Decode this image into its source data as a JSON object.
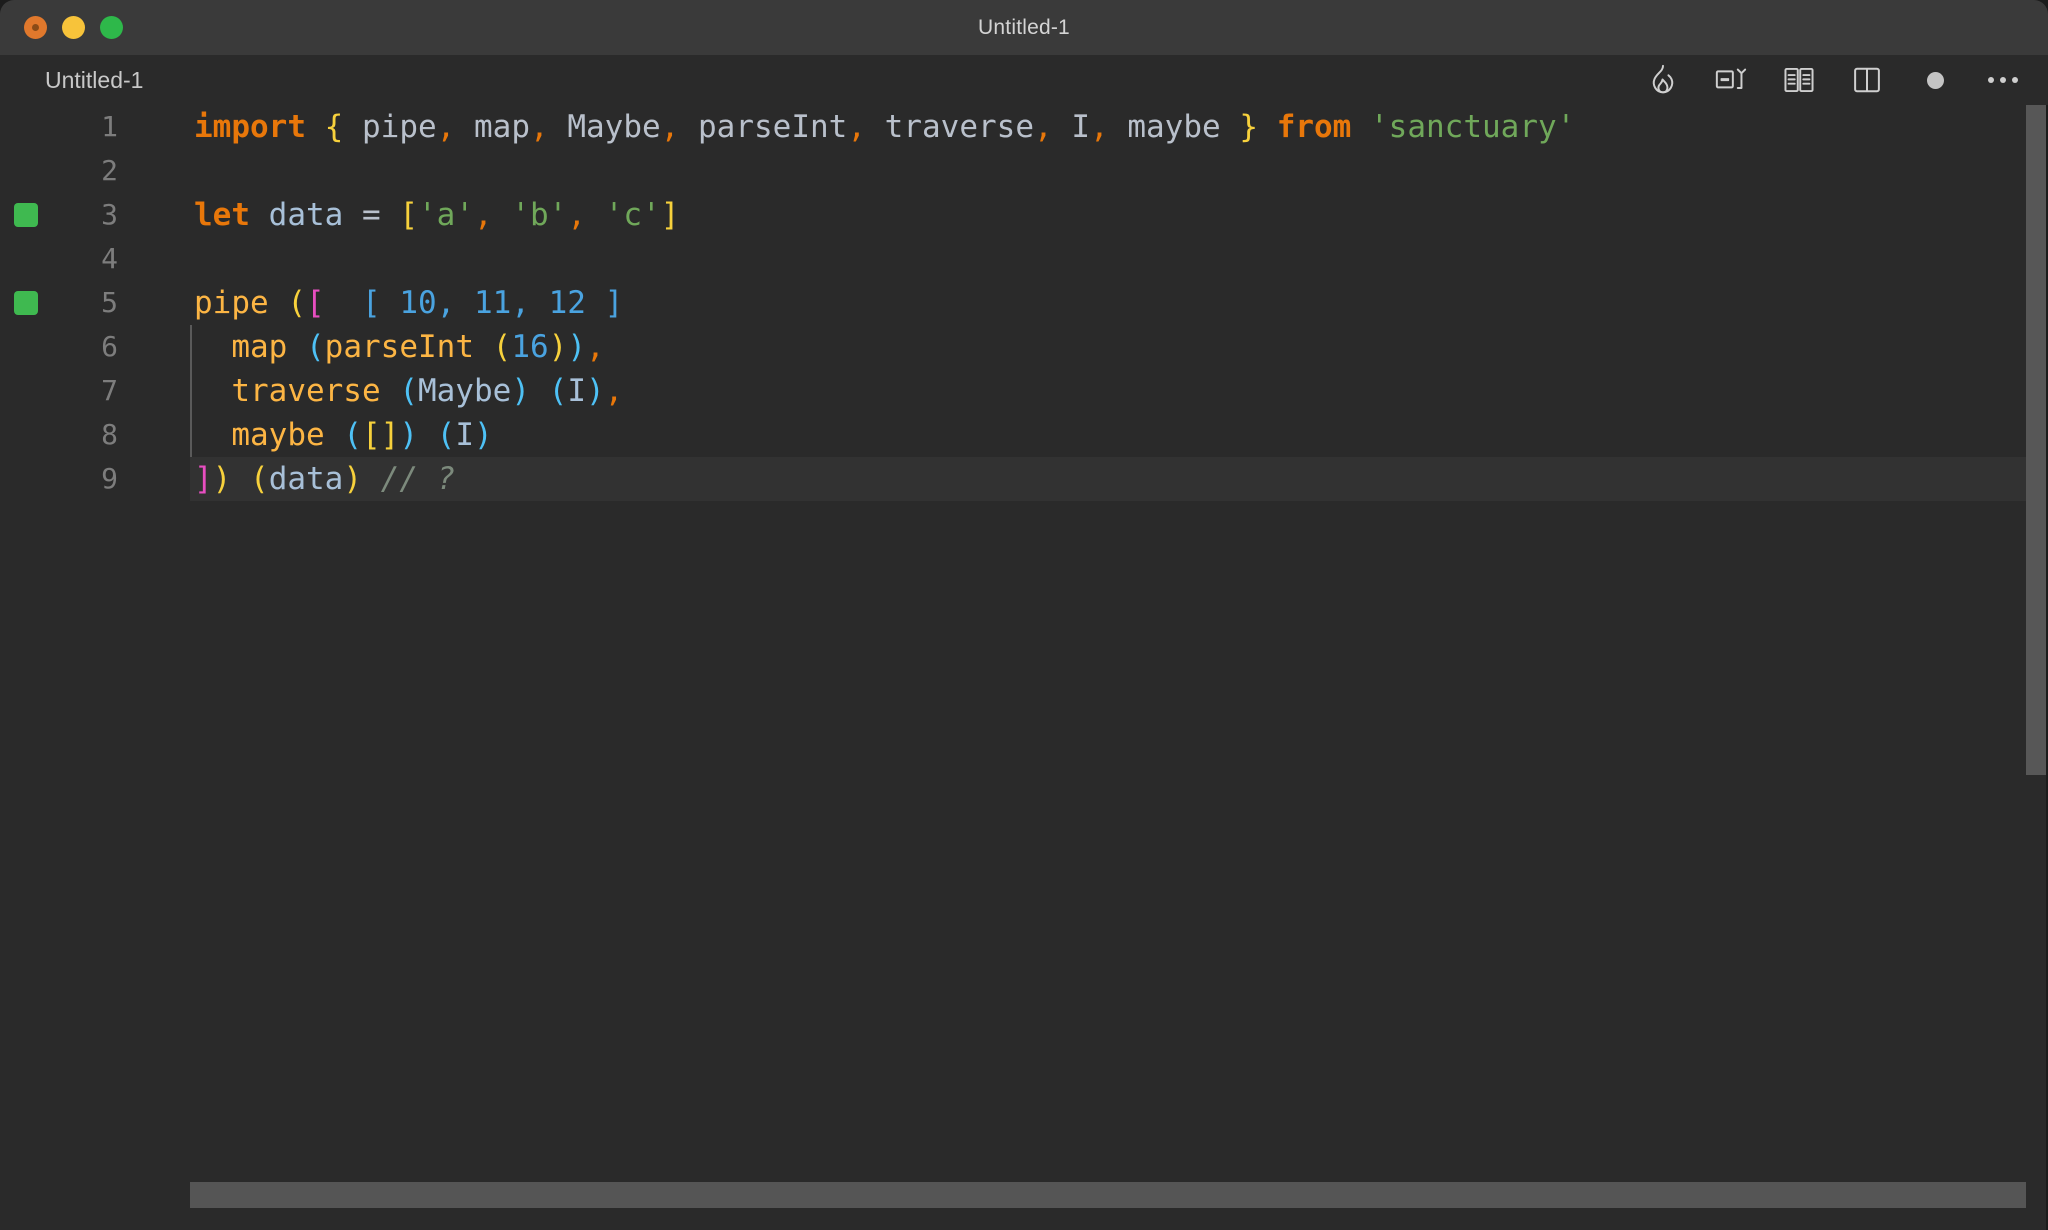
{
  "window": {
    "title": "Untitled-1",
    "traffic_lights": [
      {
        "name": "close",
        "color": "#e0782c"
      },
      {
        "name": "minimize",
        "color": "#f7c33a"
      },
      {
        "name": "maximize",
        "color": "#2eb84a"
      }
    ]
  },
  "tab": {
    "label": "Untitled-1"
  },
  "toolbar": {
    "icons": [
      {
        "name": "flame-icon",
        "title": "Quokka"
      },
      {
        "name": "run-code-icon",
        "title": "Run Code"
      },
      {
        "name": "book-preview-icon",
        "title": "Open Preview"
      },
      {
        "name": "split-editor-icon",
        "title": "Split Editor Right"
      },
      {
        "name": "unsaved-dot-icon",
        "title": "Unsaved changes"
      },
      {
        "name": "more-actions-icon",
        "title": "More Actions..."
      }
    ]
  },
  "theme": {
    "background": "#2a2a2a",
    "titlebar": "#3a3a3a",
    "current_line": "#323232",
    "gutter_text": "#7d7d7d",
    "keyword": "#e8770a",
    "identifier": "#b9c0cb",
    "variable": "#a8c0d8",
    "function": "#fcb544",
    "string": "#70a85a",
    "number": "#4aa3e0",
    "comma": "#e8770a",
    "bracket_yellow": "#f7d13c",
    "bracket_blue": "#4ec1f5",
    "bracket_magenta": "#e84ec1",
    "comment": "#7c8a7c",
    "marker_green": "#3fb950",
    "scrollbar": "#575757"
  },
  "editor": {
    "language": "javascript",
    "lines": [
      {
        "number": "1",
        "marker": false,
        "current": false,
        "indent_guide": false,
        "tokens": [
          {
            "text": "import",
            "cls": "kw"
          },
          {
            "text": " ",
            "cls": "punct"
          },
          {
            "text": "{",
            "cls": "br-yel"
          },
          {
            "text": " ",
            "cls": "punct"
          },
          {
            "text": "pipe",
            "cls": "ident"
          },
          {
            "text": ",",
            "cls": "comma"
          },
          {
            "text": " ",
            "cls": "punct"
          },
          {
            "text": "map",
            "cls": "ident"
          },
          {
            "text": ",",
            "cls": "comma"
          },
          {
            "text": " ",
            "cls": "punct"
          },
          {
            "text": "Maybe",
            "cls": "ident"
          },
          {
            "text": ",",
            "cls": "comma"
          },
          {
            "text": " ",
            "cls": "punct"
          },
          {
            "text": "parseInt",
            "cls": "ident"
          },
          {
            "text": ",",
            "cls": "comma"
          },
          {
            "text": " ",
            "cls": "punct"
          },
          {
            "text": "traverse",
            "cls": "ident"
          },
          {
            "text": ",",
            "cls": "comma"
          },
          {
            "text": " ",
            "cls": "punct"
          },
          {
            "text": "I",
            "cls": "ident"
          },
          {
            "text": ",",
            "cls": "comma"
          },
          {
            "text": " ",
            "cls": "punct"
          },
          {
            "text": "maybe",
            "cls": "ident"
          },
          {
            "text": " ",
            "cls": "punct"
          },
          {
            "text": "}",
            "cls": "br-yel"
          },
          {
            "text": " ",
            "cls": "punct"
          },
          {
            "text": "from",
            "cls": "kw"
          },
          {
            "text": " ",
            "cls": "punct"
          },
          {
            "text": "'sanctuary'",
            "cls": "str"
          }
        ]
      },
      {
        "number": "2",
        "marker": false,
        "current": false,
        "indent_guide": false,
        "tokens": []
      },
      {
        "number": "3",
        "marker": true,
        "current": false,
        "indent_guide": false,
        "tokens": [
          {
            "text": "let",
            "cls": "kw"
          },
          {
            "text": " ",
            "cls": "punct"
          },
          {
            "text": "data",
            "cls": "var"
          },
          {
            "text": " ",
            "cls": "punct"
          },
          {
            "text": "=",
            "cls": "op"
          },
          {
            "text": " ",
            "cls": "punct"
          },
          {
            "text": "[",
            "cls": "br-yel"
          },
          {
            "text": "'a'",
            "cls": "str"
          },
          {
            "text": ",",
            "cls": "comma"
          },
          {
            "text": " ",
            "cls": "punct"
          },
          {
            "text": "'b'",
            "cls": "str"
          },
          {
            "text": ",",
            "cls": "comma"
          },
          {
            "text": " ",
            "cls": "punct"
          },
          {
            "text": "'c'",
            "cls": "str"
          },
          {
            "text": "]",
            "cls": "br-yel"
          }
        ]
      },
      {
        "number": "4",
        "marker": false,
        "current": false,
        "indent_guide": false,
        "tokens": []
      },
      {
        "number": "5",
        "marker": true,
        "current": false,
        "indent_guide": false,
        "tokens": [
          {
            "text": "pipe",
            "cls": "fn"
          },
          {
            "text": " ",
            "cls": "punct"
          },
          {
            "text": "(",
            "cls": "br-yel"
          },
          {
            "text": "[",
            "cls": "br-mag"
          },
          {
            "text": "  [ 10, 11, 12 ]",
            "cls": "hint"
          }
        ]
      },
      {
        "number": "6",
        "marker": false,
        "current": false,
        "indent_guide": true,
        "tokens": [
          {
            "text": "  ",
            "cls": "punct"
          },
          {
            "text": "map",
            "cls": "fn"
          },
          {
            "text": " ",
            "cls": "punct"
          },
          {
            "text": "(",
            "cls": "br-blu"
          },
          {
            "text": "parseInt",
            "cls": "fn"
          },
          {
            "text": " ",
            "cls": "punct"
          },
          {
            "text": "(",
            "cls": "br-yel"
          },
          {
            "text": "16",
            "cls": "num"
          },
          {
            "text": ")",
            "cls": "br-yel"
          },
          {
            "text": ")",
            "cls": "br-blu"
          },
          {
            "text": ",",
            "cls": "comma"
          }
        ]
      },
      {
        "number": "7",
        "marker": false,
        "current": false,
        "indent_guide": true,
        "tokens": [
          {
            "text": "  ",
            "cls": "punct"
          },
          {
            "text": "traverse",
            "cls": "fn"
          },
          {
            "text": " ",
            "cls": "punct"
          },
          {
            "text": "(",
            "cls": "br-blu"
          },
          {
            "text": "Maybe",
            "cls": "var"
          },
          {
            "text": ")",
            "cls": "br-blu"
          },
          {
            "text": " ",
            "cls": "punct"
          },
          {
            "text": "(",
            "cls": "br-blu"
          },
          {
            "text": "I",
            "cls": "var"
          },
          {
            "text": ")",
            "cls": "br-blu"
          },
          {
            "text": ",",
            "cls": "comma"
          }
        ]
      },
      {
        "number": "8",
        "marker": false,
        "current": false,
        "indent_guide": true,
        "tokens": [
          {
            "text": "  ",
            "cls": "punct"
          },
          {
            "text": "maybe",
            "cls": "fn"
          },
          {
            "text": " ",
            "cls": "punct"
          },
          {
            "text": "(",
            "cls": "br-blu"
          },
          {
            "text": "[]",
            "cls": "br-yel"
          },
          {
            "text": ")",
            "cls": "br-blu"
          },
          {
            "text": " ",
            "cls": "punct"
          },
          {
            "text": "(",
            "cls": "br-blu"
          },
          {
            "text": "I",
            "cls": "var"
          },
          {
            "text": ")",
            "cls": "br-blu"
          }
        ]
      },
      {
        "number": "9",
        "marker": false,
        "current": true,
        "indent_guide": false,
        "tokens": [
          {
            "text": "]",
            "cls": "br-mag"
          },
          {
            "text": ")",
            "cls": "br-yel"
          },
          {
            "text": " ",
            "cls": "punct"
          },
          {
            "text": "(",
            "cls": "br-yel"
          },
          {
            "text": "data",
            "cls": "var"
          },
          {
            "text": ")",
            "cls": "br-yel"
          },
          {
            "text": " ",
            "cls": "punct"
          },
          {
            "text": "// ?",
            "cls": "comment"
          }
        ]
      }
    ]
  }
}
